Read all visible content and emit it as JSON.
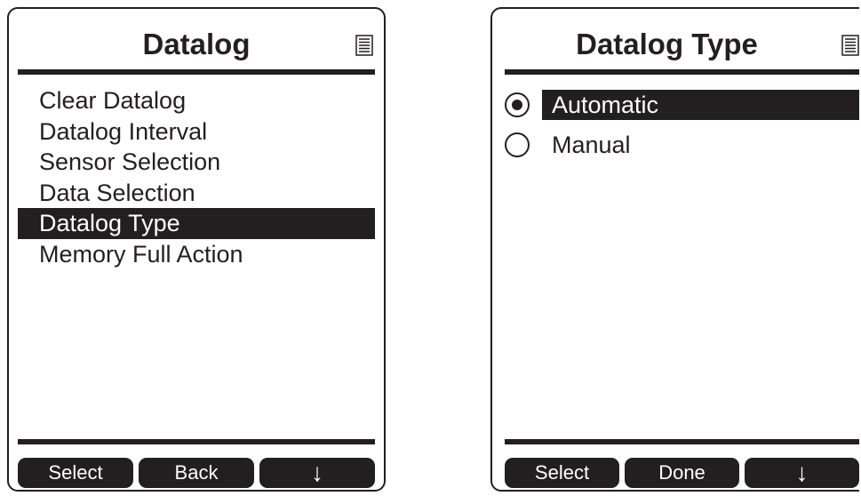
{
  "left_screen": {
    "title": "Datalog",
    "menu_icon": "list-menu-icon",
    "items": [
      {
        "label": "Clear Datalog",
        "selected": false
      },
      {
        "label": "Datalog Interval",
        "selected": false
      },
      {
        "label": "Sensor Selection",
        "selected": false
      },
      {
        "label": "Data Selection",
        "selected": false
      },
      {
        "label": "Datalog Type",
        "selected": true
      },
      {
        "label": "Memory Full Action",
        "selected": false
      }
    ],
    "softkeys": [
      "Select",
      "Back",
      "↓"
    ]
  },
  "right_screen": {
    "title": "Datalog Type",
    "menu_icon": "list-menu-icon",
    "options": [
      {
        "label": "Automatic",
        "checked": true,
        "highlighted": true
      },
      {
        "label": "Manual",
        "checked": false,
        "highlighted": false
      }
    ],
    "softkeys": [
      "Select",
      "Done",
      "↓"
    ]
  },
  "colors": {
    "ink": "#231f20",
    "background": "#ffffff"
  }
}
